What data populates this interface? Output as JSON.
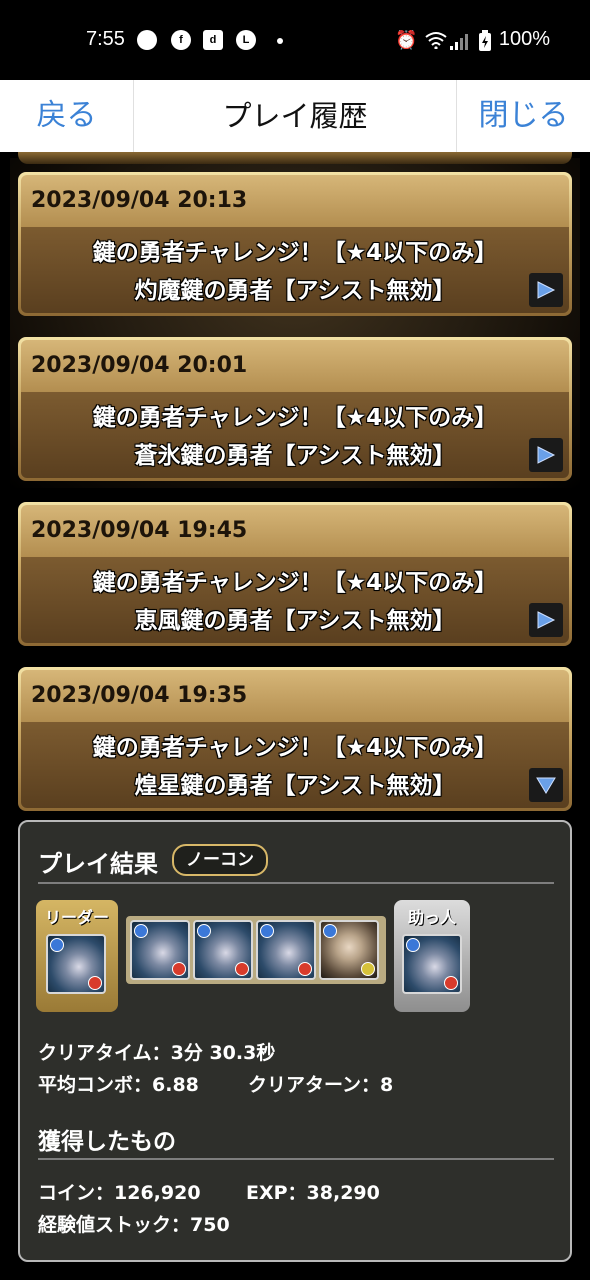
{
  "status_bar": {
    "time": "7:55",
    "battery": "100%",
    "icons": [
      "record-icon",
      "facebook-icon",
      "dpoint-icon",
      "line-icon",
      "alarm-icon",
      "wifi-icon",
      "signal-icon",
      "battery-icon"
    ]
  },
  "header": {
    "back_label": "戻る",
    "title": "プレイ履歴",
    "close_label": "閉じる"
  },
  "history": [
    {
      "date": "2023/09/04 20:13",
      "line1": "鍵の勇者チャレンジ！【★4以下のみ】",
      "line2": "灼魔鍵の勇者【アシスト無効】",
      "arrow": "right"
    },
    {
      "date": "2023/09/04 20:01",
      "line1": "鍵の勇者チャレンジ！【★4以下のみ】",
      "line2": "蒼氷鍵の勇者【アシスト無効】",
      "arrow": "right"
    },
    {
      "date": "2023/09/04 19:45",
      "line1": "鍵の勇者チャレンジ！【★4以下のみ】",
      "line2": "恵風鍵の勇者【アシスト無効】",
      "arrow": "right"
    },
    {
      "date": "2023/09/04 19:35",
      "line1": "鍵の勇者チャレンジ！【★4以下のみ】",
      "line2": "煌星鍵の勇者【アシスト無効】",
      "arrow": "down"
    }
  ],
  "result": {
    "title": "プレイ結果",
    "badge": "ノーコン",
    "leader_label": "リーダー",
    "helper_label": "助っ人",
    "clear_time": "クリアタイム：3分 30.3秒",
    "avg_combo": "平均コンボ：6.88",
    "clear_turn": "クリアターン：8",
    "obtained_title": "獲得したもの",
    "coin": "コイン：126,920",
    "exp": "EXP：38,290",
    "exp_stock": "経験値ストック：750"
  },
  "colors": {
    "link_blue": "#3b82d6",
    "card_gold": "#c8a663",
    "panel_bg": "#2e2f2b"
  }
}
